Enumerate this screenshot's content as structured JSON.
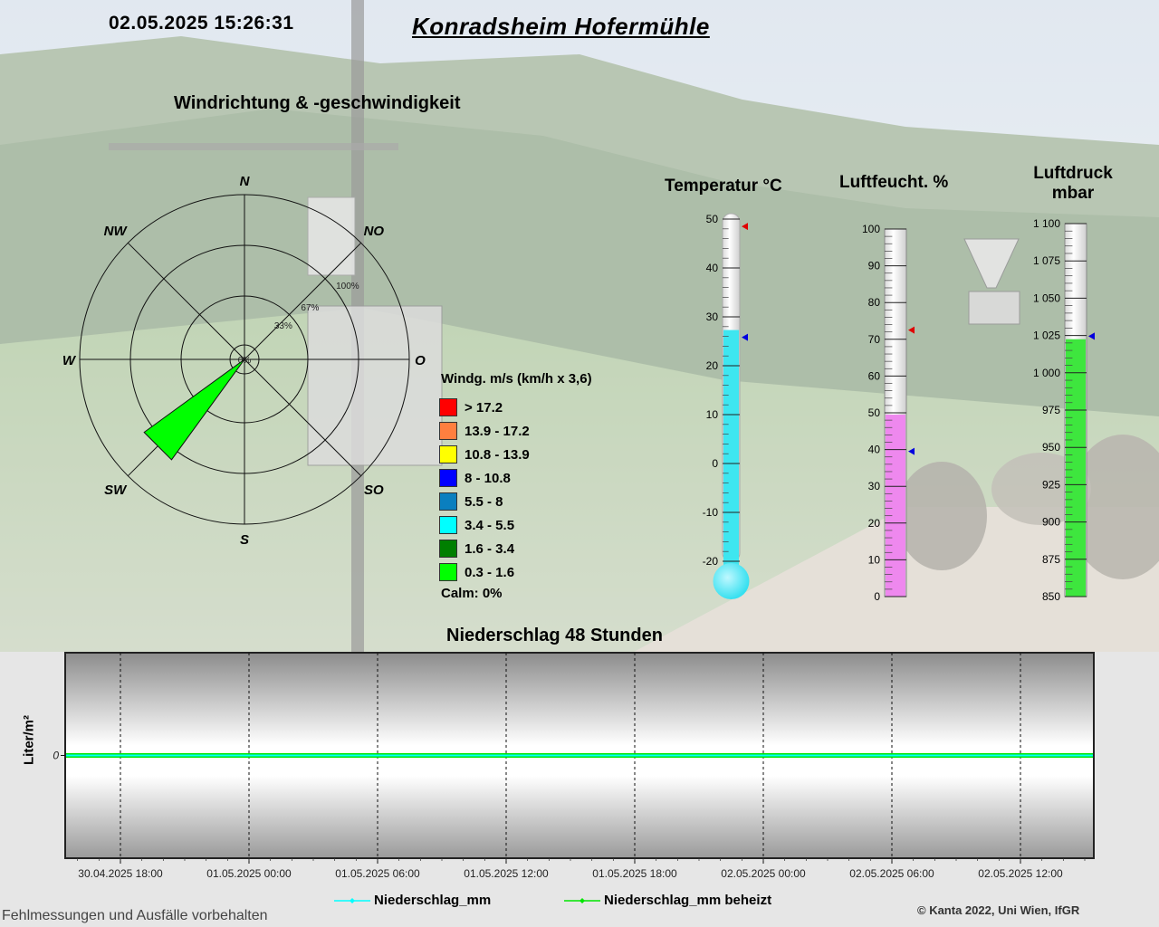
{
  "header": {
    "timestamp": "02.05.2025 15:26:31",
    "station": "Konradsheim Hofermühle"
  },
  "wind": {
    "title": "Windrichtung & -geschwindigkeit",
    "directions": [
      "N",
      "NO",
      "O",
      "SO",
      "S",
      "SW",
      "W",
      "NW"
    ],
    "rings": [
      "0%",
      "33%",
      "67%",
      "100%"
    ],
    "legend_title": "Windg. m/s (km/h x 3,6)",
    "classes": [
      {
        "label": "> 17.2",
        "color": "#ff0000"
      },
      {
        "label": "13.9 - 17.2",
        "color": "#ff7f3f"
      },
      {
        "label": "10.8 - 13.9",
        "color": "#ffff00"
      },
      {
        "label": "8 - 10.8",
        "color": "#0000ff"
      },
      {
        "label": "5.5 - 8",
        "color": "#0a7fbf"
      },
      {
        "label": "3.4 - 5.5",
        "color": "#00ffff"
      },
      {
        "label": "1.6 - 3.4",
        "color": "#007f00"
      },
      {
        "label": "0.3 - 1.6",
        "color": "#00ff00"
      }
    ],
    "calm": "Calm: 0%"
  },
  "gauges": {
    "temperature": {
      "title": "Temperatur °C",
      "min": -20,
      "max": 50,
      "ticks": [
        "-20",
        "-10",
        "0",
        "10",
        "20",
        "30",
        "40",
        "50"
      ],
      "value": 27.3,
      "max_marker": 48.5,
      "min_marker": 25.8,
      "fill_color": "#3ee6f0"
    },
    "humidity": {
      "title": "Luftfeucht. %",
      "min": 0,
      "max": 100,
      "ticks": [
        "0",
        "10",
        "20",
        "30",
        "40",
        "50",
        "60",
        "70",
        "80",
        "90",
        "100"
      ],
      "value": 49.5,
      "max_marker": 72.5,
      "min_marker": 39.5,
      "fill_color": "#ee88ee"
    },
    "pressure": {
      "title_line1": "Luftdruck",
      "title_line2": "mbar",
      "min": 850,
      "max": 1100,
      "ticks": [
        "850",
        "875",
        "900",
        "925",
        "950",
        "975",
        "1 000",
        "1 025",
        "1 050",
        "1 075",
        "1 100"
      ],
      "value": 1022.5,
      "max_marker": 1024.5,
      "min_marker": 1024.5,
      "fill_color": "#3ee63e"
    }
  },
  "precip": {
    "title": "Niederschlag 48 Stunden",
    "ylabel": "Liter/m²",
    "ytick": "0",
    "xticks": [
      "30.04.2025 18:00",
      "01.05.2025 00:00",
      "01.05.2025 06:00",
      "01.05.2025 12:00",
      "01.05.2025 18:00",
      "02.05.2025 00:00",
      "02.05.2025 06:00",
      "02.05.2025 12:00"
    ],
    "legend": [
      "Niederschlag_mm",
      "Niederschlag_mm beheizt"
    ],
    "series_colors": [
      "#00ffff",
      "#00e600"
    ]
  },
  "chart_data": [
    {
      "type": "polar-bar",
      "title": "Windrichtung & -geschwindigkeit",
      "directions": [
        "N",
        "NO",
        "O",
        "SO",
        "S",
        "SW",
        "W",
        "NW"
      ],
      "series": [
        {
          "name": "0.3 - 1.6",
          "values": [
            0,
            0,
            0,
            0,
            0,
            100,
            0,
            0
          ]
        }
      ],
      "calm_percent": 0
    },
    {
      "type": "line",
      "title": "Niederschlag 48 Stunden",
      "ylabel": "Liter/m²",
      "series": [
        {
          "name": "Niederschlag_mm",
          "values": [
            0
          ]
        },
        {
          "name": "Niederschlag_mm beheizt",
          "values": [
            0
          ]
        }
      ]
    }
  ],
  "footer": {
    "disclaimer": "Fehlmessungen und Ausfälle vorbehalten",
    "copyright": "© Kanta 2022, Uni Wien, IfGR"
  }
}
